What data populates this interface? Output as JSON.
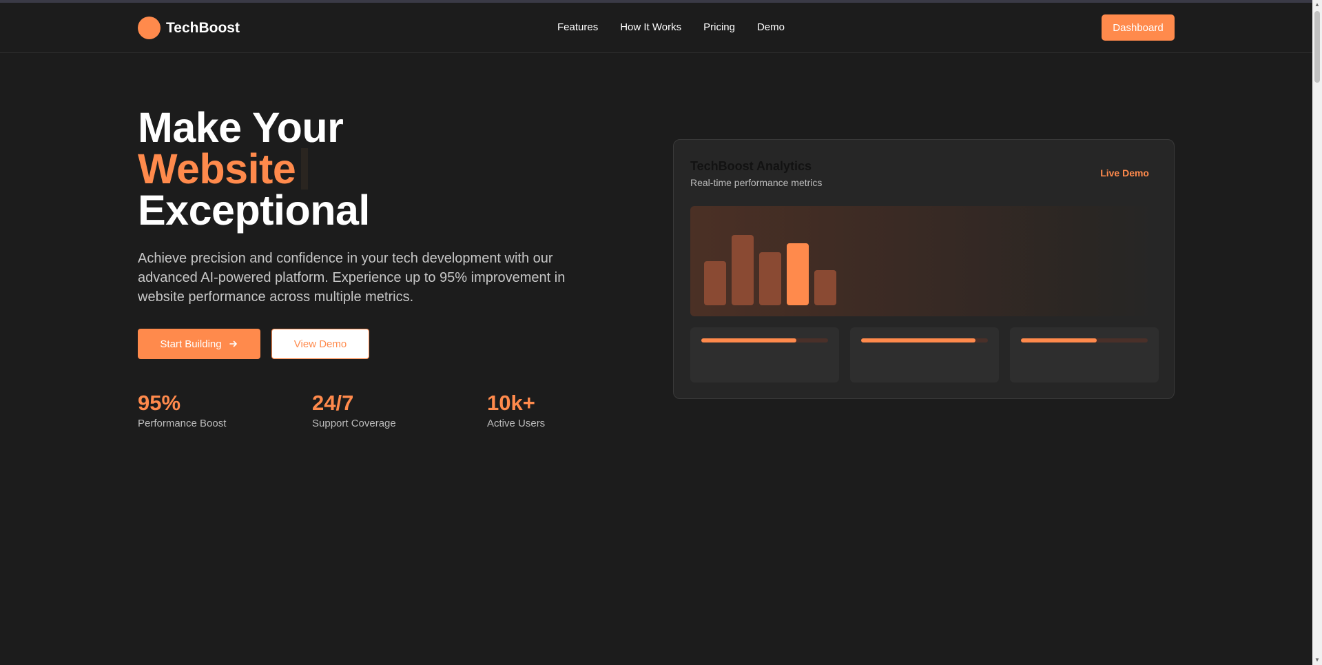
{
  "brand": {
    "name": "TechBoost",
    "accent": "#ff8a4c",
    "background": "#1c1c1c"
  },
  "nav": {
    "items": [
      "Features",
      "How It Works",
      "Pricing",
      "Demo"
    ],
    "dashboard_label": "Dashboard"
  },
  "hero": {
    "line1": "Make Your",
    "line2": "Website",
    "line3": "Exceptional",
    "description": "Achieve precision and confidence in your tech development with our advanced AI-powered platform. Experience up to 95% improvement in website performance across multiple metrics.",
    "primary_cta": "Start Building",
    "primary_cta_icon": "arrow-right-icon",
    "secondary_cta": "View Demo"
  },
  "stats": [
    {
      "value": "95%",
      "label": "Performance Boost"
    },
    {
      "value": "24/7",
      "label": "Support Coverage"
    },
    {
      "value": "10k+",
      "label": "Active Users"
    }
  ],
  "analytics_card": {
    "title": "TechBoost Analytics",
    "subtitle": "Real-time performance metrics",
    "badge": "Live Demo",
    "bars": [
      0.5,
      0.8,
      0.6,
      0.7,
      0.4
    ],
    "highlighted_bar": 3,
    "progress": [
      0.75,
      0.9,
      0.6
    ]
  }
}
